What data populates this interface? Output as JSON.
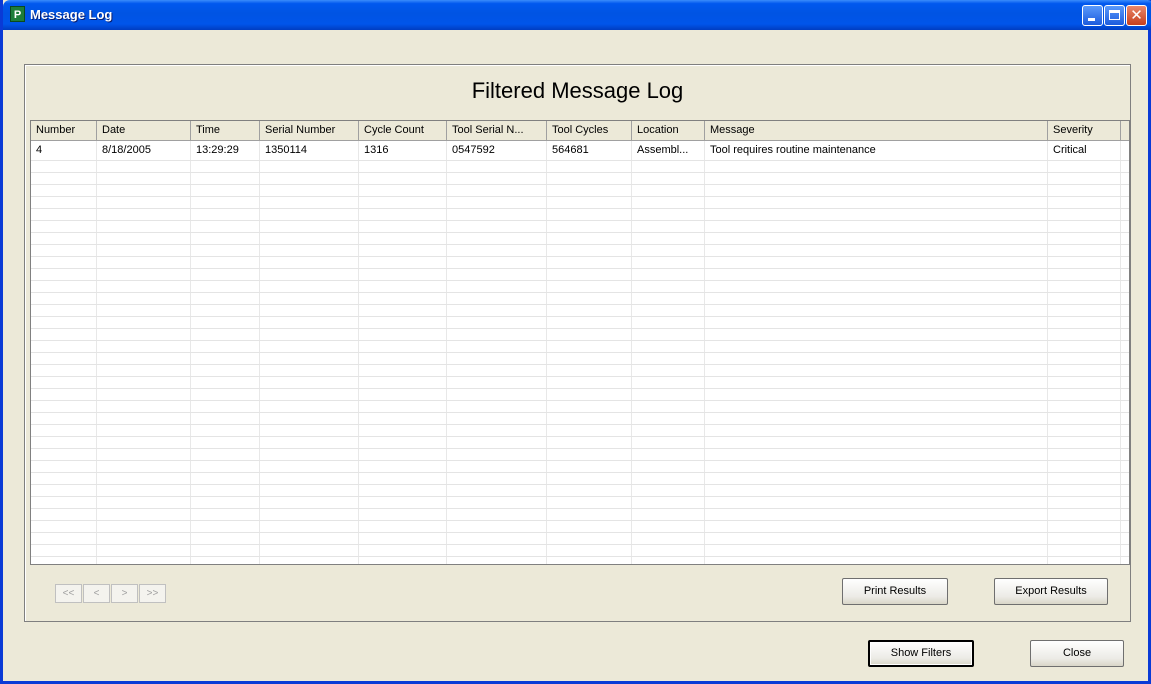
{
  "window": {
    "title": "Message Log",
    "app_icon": "P"
  },
  "heading": "Filtered Message Log",
  "table": {
    "columns": [
      "Number",
      "Date",
      "Time",
      "Serial Number",
      "Cycle Count",
      "Tool Serial N...",
      "Tool Cycles",
      "Location",
      "Message",
      "Severity"
    ],
    "rows": [
      [
        "4",
        "8/18/2005",
        "13:29:29",
        "1350114",
        "1316",
        "0547592",
        "564681",
        "Assembl...",
        "Tool requires routine maintenance",
        "Critical"
      ]
    ]
  },
  "pager": {
    "first": "<<",
    "prev": "<",
    "next": ">",
    "last": ">>"
  },
  "buttons": {
    "print": "Print Results",
    "export": "Export Results",
    "show_filters": "Show Filters",
    "close": "Close"
  },
  "icons": {
    "app": "app-icon",
    "minimize": "minimize-icon",
    "maximize": "maximize-icon",
    "close": "close-icon"
  },
  "colors": {
    "titlebar": "#0054E3",
    "window_bg": "#ECE9D8",
    "close_button": "#C63F1E"
  }
}
